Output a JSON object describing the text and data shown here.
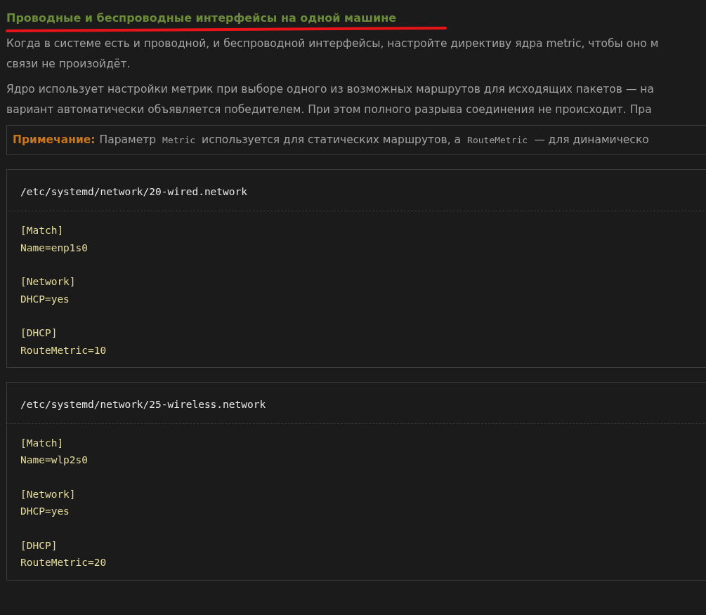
{
  "heading": "Проводные и беспроводные интерфейсы на одной машине",
  "paragraphs": [
    {
      "lines": [
        "Когда в системе есть и проводной, и беспроводной интерфейсы, настройте директиву ядра metric, чтобы оно м",
        "связи не произойдёт."
      ]
    },
    {
      "lines": [
        "Ядро использует настройки метрик при выборе одного из возможных маршрутов для исходящих пакетов — на",
        "вариант автоматически объявляется победителем. При этом полного разрыва соединения не происходит. Пра"
      ]
    }
  ],
  "note": {
    "label": "Примечание:",
    "parts": [
      {
        "kind": "text",
        "text": "Параметр"
      },
      {
        "kind": "code",
        "text": "Metric"
      },
      {
        "kind": "text",
        "text": "используется для статических маршрутов, а"
      },
      {
        "kind": "code",
        "text": "RouteMetric"
      },
      {
        "kind": "text",
        "text": "— для динамическо"
      }
    ]
  },
  "code_blocks": [
    {
      "filename": "/etc/systemd/network/20-wired.network",
      "sections": [
        {
          "header": "[Match]",
          "lines": [
            "Name=enp1s0"
          ]
        },
        {
          "header": "[Network]",
          "lines": [
            "DHCP=yes"
          ]
        },
        {
          "header": "[DHCP]",
          "lines": [
            "RouteMetric=10"
          ]
        }
      ]
    },
    {
      "filename": "/etc/systemd/network/25-wireless.network",
      "sections": [
        {
          "header": "[Match]",
          "lines": [
            "Name=wlp2s0"
          ]
        },
        {
          "header": "[Network]",
          "lines": [
            "DHCP=yes"
          ]
        },
        {
          "header": "[DHCP]",
          "lines": [
            "RouteMetric=20"
          ]
        }
      ]
    }
  ]
}
